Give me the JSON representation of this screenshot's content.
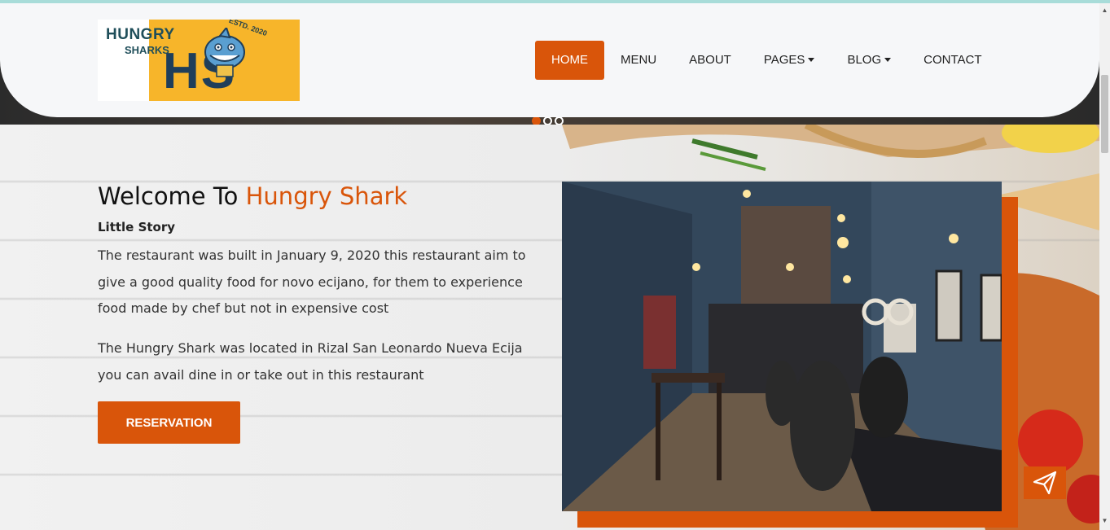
{
  "brand": {
    "logo_line1": "HUNGRY",
    "logo_line2": "SHARKS",
    "logo_est": "ESTD. 2020",
    "logo_monogram": "HS"
  },
  "nav": {
    "items": [
      {
        "label": "HOME",
        "active": true,
        "dropdown": false
      },
      {
        "label": "MENU",
        "active": false,
        "dropdown": false
      },
      {
        "label": "ABOUT",
        "active": false,
        "dropdown": false
      },
      {
        "label": "PAGES",
        "active": false,
        "dropdown": true
      },
      {
        "label": "BLOG",
        "active": false,
        "dropdown": true
      },
      {
        "label": "CONTACT",
        "active": false,
        "dropdown": false
      }
    ]
  },
  "hero": {
    "carousel": {
      "slides": 3,
      "active_index": 0
    }
  },
  "about": {
    "title_prefix": "Welcome To ",
    "title_accent": "Hungry Shark",
    "subtitle": "Little Story",
    "paragraph1": "The restaurant was built in January 9, 2020 this restaurant aim to give a good quality food for novo ecijano, for them to experience food made by chef but not in expensive cost",
    "paragraph2": "The Hungry Shark was located in Rizal San Leonardo Nueva Ecija you can avail dine in or take out in this restaurant",
    "button_label": "RESERVATION"
  },
  "icons": {
    "send": "paper-plane-icon"
  },
  "colors": {
    "accent": "#d9550a",
    "header_bg": "#f6f7f9",
    "logo_yellow": "#f7b52a",
    "logo_navy": "#1f3e5a"
  }
}
